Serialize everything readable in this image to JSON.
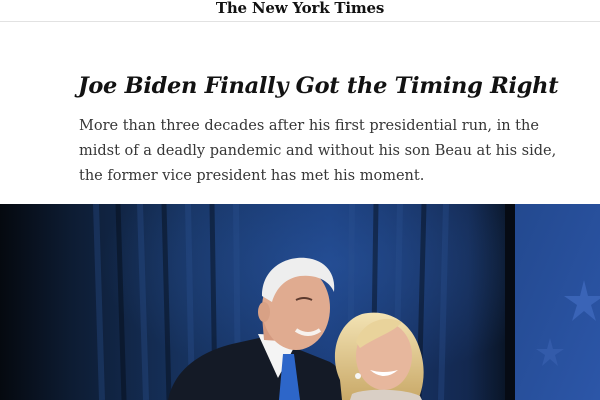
{
  "masthead": {
    "title": "The New York Times"
  },
  "article": {
    "headline": "Joe Biden Finally Got the Timing Right",
    "summary_lines": [
      "More than three decades after his first presidential run, in the",
      "midst of a deadly pandemic and without his son Beau at his side,",
      "the former vice president has met his moment."
    ]
  },
  "hero_image": {
    "icon": "photo-icon"
  },
  "colors": {
    "text": "#121212",
    "summary_text": "#363636",
    "rule": "#e2e2e2",
    "backdrop_dark": "#0b1420",
    "curtain_blue": "#1b3d7a",
    "flag_blue": "#2c56a8"
  }
}
